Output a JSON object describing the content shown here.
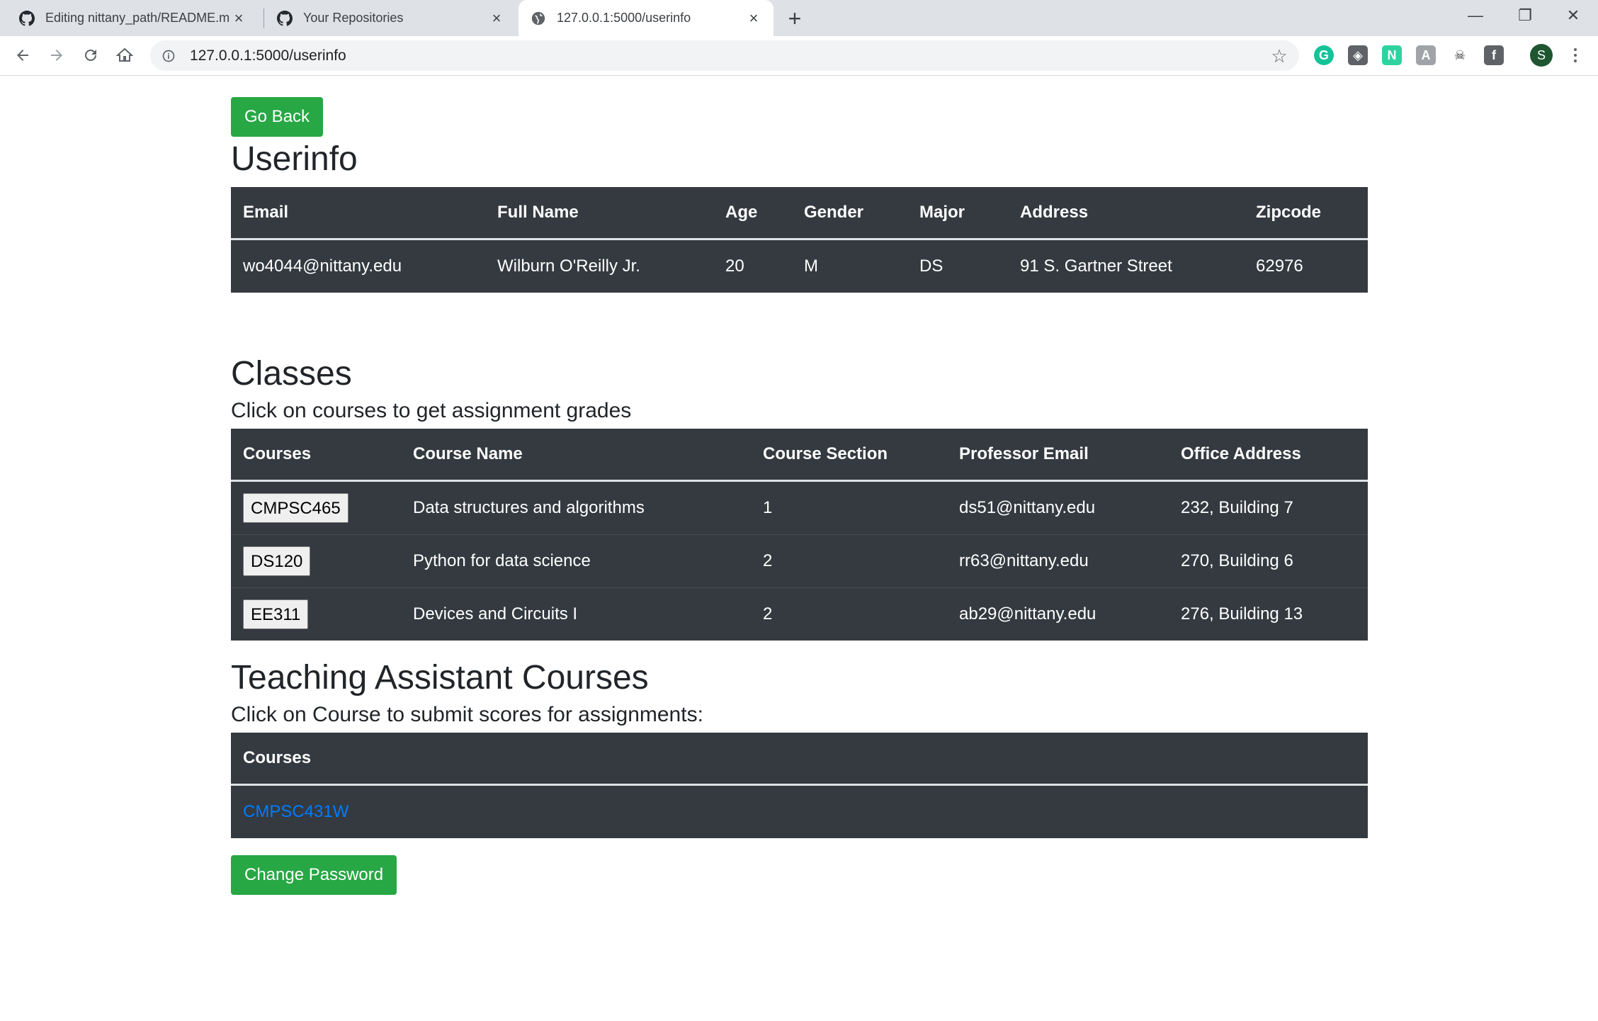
{
  "browser": {
    "tabs": [
      {
        "title": "Editing nittany_path/README.md",
        "close": "×"
      },
      {
        "title": "Your Repositories",
        "close": "×"
      },
      {
        "title": "127.0.0.1:5000/userinfo",
        "close": "×"
      }
    ],
    "new_tab": "+",
    "url": "127.0.0.1:5000/userinfo",
    "profile_initial": "S",
    "window_controls": {
      "minimize": "—",
      "restore": "❐",
      "close": "✕"
    }
  },
  "page": {
    "go_back": "Go Back",
    "userinfo_title": "Userinfo",
    "userinfo_headers": [
      "Email",
      "Full Name",
      "Age",
      "Gender",
      "Major",
      "Address",
      "Zipcode"
    ],
    "userinfo_row": [
      "wo4044@nittany.edu",
      "Wilburn O'Reilly Jr.",
      "20",
      "M",
      "DS",
      "91 S. Gartner Street",
      "62976"
    ],
    "classes_title": "Classes",
    "classes_subtitle": "Click on courses to get assignment grades",
    "classes_headers": [
      "Courses",
      "Course Name",
      "Course Section",
      "Professor Email",
      "Office Address"
    ],
    "classes_rows": [
      [
        "CMPSC465",
        "Data structures and algorithms",
        "1",
        "ds51@nittany.edu",
        "232, Building 7"
      ],
      [
        "DS120",
        "Python for data science",
        "2",
        "rr63@nittany.edu",
        "270, Building 6"
      ],
      [
        "EE311",
        "Devices and Circuits I",
        "2",
        "ab29@nittany.edu",
        "276, Building 13"
      ]
    ],
    "ta_title": "Teaching Assistant Courses",
    "ta_subtitle": "Click on Course to submit scores for assignments:",
    "ta_header": "Courses",
    "ta_course": "CMPSC431W",
    "change_password": "Change Password"
  },
  "colors": {
    "success": "#28a745",
    "table_dark": "#343a40",
    "link": "#007bff"
  },
  "icons": [
    "github-icon",
    "globe-icon",
    "back-arrow-icon",
    "forward-arrow-icon",
    "reload-icon",
    "home-icon",
    "info-icon",
    "star-icon",
    "grammarly-icon",
    "extension-icon",
    "notion-icon",
    "extension-icon",
    "pirate-icon",
    "facebook-icon",
    "kebab-menu-icon"
  ]
}
